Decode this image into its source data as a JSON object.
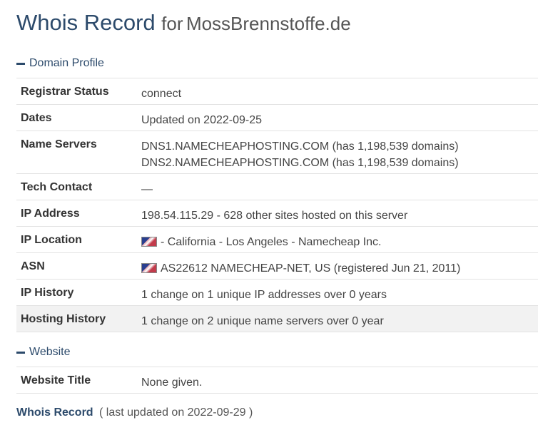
{
  "title": {
    "main": "Whois Record",
    "for": "for",
    "domain": "MossBrennstoffe.de"
  },
  "domain_profile": {
    "heading": "Domain Profile",
    "rows": [
      {
        "key": "Registrar Status",
        "values": [
          "connect"
        ]
      },
      {
        "key": "Dates",
        "values": [
          "Updated on 2022-09-25"
        ]
      },
      {
        "key": "Name Servers",
        "values": [
          "DNS1.NAMECHEAPHOSTING.COM (has 1,198,539 domains)",
          "DNS2.NAMECHEAPHOSTING.COM (has 1,198,539 domains)"
        ]
      },
      {
        "key": "Tech Contact",
        "values": [
          "—"
        ]
      },
      {
        "key": "IP Address",
        "values": [
          "198.54.115.29 - 628 other sites hosted on this server"
        ]
      },
      {
        "key": "IP Location",
        "values": [
          "- California - Los Angeles - Namecheap Inc."
        ],
        "flag": "us-flag-icon"
      },
      {
        "key": "ASN",
        "values": [
          "AS22612 NAMECHEAP-NET, US (registered Jun 21, 2011)"
        ],
        "flag": "us-flag-icon"
      },
      {
        "key": "IP History",
        "values": [
          "1 change on 1 unique IP addresses over 0 years"
        ]
      },
      {
        "key": "Hosting History",
        "values": [
          "1 change on 2 unique name servers over 0 year"
        ]
      }
    ]
  },
  "website": {
    "heading": "Website",
    "rows": [
      {
        "key": "Website Title",
        "values": [
          "None given."
        ]
      }
    ]
  },
  "footer": {
    "link": "Whois Record",
    "note": "( last updated on 2022-09-29 )"
  },
  "colors": {
    "accent": "#2c4a6b",
    "row_shade": "#f2f2f2",
    "border": "#e3e3e3"
  }
}
